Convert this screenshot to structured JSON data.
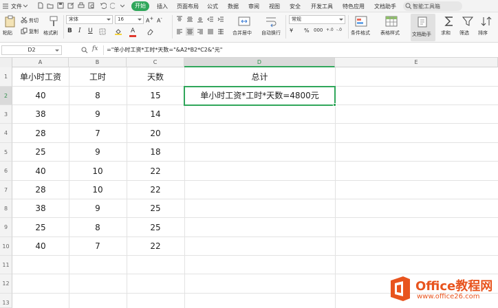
{
  "menubar": {
    "file_label": "文件",
    "tabs": [
      "开始",
      "插入",
      "页面布局",
      "公式",
      "数据",
      "审阅",
      "视图",
      "安全",
      "开发工具",
      "特色应用",
      "文档助手"
    ],
    "active_tab": "开始",
    "search_label": "智能工具箱"
  },
  "ribbon": {
    "paste": "粘贴",
    "cut": "剪切",
    "copy": "复制",
    "format_painter": "格式刷",
    "font_name": "宋体",
    "font_size": "16",
    "merge_center": "合并居中",
    "wrap_text": "自动换行",
    "number_format": "常规",
    "conditional_format": "条件格式",
    "table_style": "表格样式",
    "doc_assistant": "文档助手",
    "sum": "求和",
    "filter": "筛选",
    "sort": "排序",
    "font_color_accent": "#e03a2e"
  },
  "formula_bar": {
    "cell_ref": "D2",
    "fx": "fx",
    "formula": "=\"单小时工资*工时*天数=\"&A2*B2*C2&\"元\""
  },
  "grid": {
    "columns": [
      "A",
      "B",
      "C",
      "D",
      "E"
    ],
    "rows": [
      "1",
      "2",
      "3",
      "4",
      "5",
      "6",
      "7",
      "8",
      "9",
      "10",
      "11",
      "12",
      "13"
    ],
    "headers": [
      "单小时工资",
      "工时",
      "天数",
      "总计"
    ],
    "data": [
      [
        "40",
        "8",
        "15"
      ],
      [
        "38",
        "9",
        "14"
      ],
      [
        "28",
        "7",
        "20"
      ],
      [
        "25",
        "9",
        "18"
      ],
      [
        "40",
        "10",
        "22"
      ],
      [
        "28",
        "10",
        "22"
      ],
      [
        "38",
        "9",
        "25"
      ],
      [
        "25",
        "8",
        "25"
      ],
      [
        "40",
        "7",
        "22"
      ]
    ],
    "d2_value": "单小时工资*工时*天数=4800元",
    "selected_cell": "D2",
    "accent_color": "#2fa65a"
  },
  "watermark": {
    "name": "Office教程网",
    "url": "www.office26.com"
  }
}
